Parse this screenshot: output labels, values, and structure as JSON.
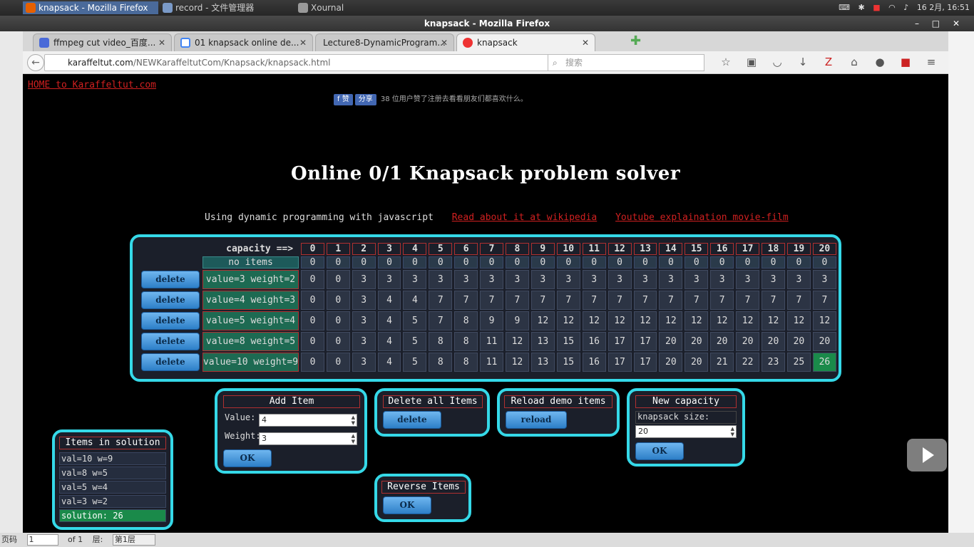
{
  "os": {
    "tasks": [
      "knapsack - Mozilla Firefox",
      "record - 文件管理器",
      "Xournal"
    ],
    "clock": "16 2月, 16:51"
  },
  "window": {
    "title": "knapsack - Mozilla Firefox"
  },
  "browser": {
    "tabs": [
      {
        "label": "ffmpeg cut video_百度..."
      },
      {
        "label": "01 knapsack online de..."
      },
      {
        "label": "Lecture8-DynamicProgram..."
      },
      {
        "label": "knapsack"
      }
    ],
    "url_host": "karaffeltut.com",
    "url_path": "/NEWKaraffeltutCom/Knapsack/knapsack.html",
    "search_placeholder": "搜索"
  },
  "page": {
    "home_link": "HOME to Karaffeltut.com",
    "fb": {
      "like": "赞",
      "share": "分享",
      "text": "38 位用户赞了注册去看看朋友们都喜欢什么。"
    },
    "title": "Online 0/1 Knapsack problem solver",
    "subtitle": "Using dynamic programming with javascript",
    "link_wiki": "Read about it at wikipedia",
    "link_youtube": "Youtube explaination movie-film"
  },
  "table": {
    "capacity_label": "capacity ==>",
    "capacities": [
      "0",
      "1",
      "2",
      "3",
      "4",
      "5",
      "6",
      "7",
      "8",
      "9",
      "10",
      "11",
      "12",
      "13",
      "14",
      "15",
      "16",
      "17",
      "18",
      "19",
      "20"
    ],
    "no_items_label": "no items",
    "no_items_row": [
      "0",
      "0",
      "0",
      "0",
      "0",
      "0",
      "0",
      "0",
      "0",
      "0",
      "0",
      "0",
      "0",
      "0",
      "0",
      "0",
      "0",
      "0",
      "0",
      "0",
      "0"
    ],
    "delete_label": "delete",
    "rows": [
      {
        "label": "value=3 weight=2",
        "values": [
          "0",
          "0",
          "3",
          "3",
          "3",
          "3",
          "3",
          "3",
          "3",
          "3",
          "3",
          "3",
          "3",
          "3",
          "3",
          "3",
          "3",
          "3",
          "3",
          "3",
          "3"
        ]
      },
      {
        "label": "value=4 weight=3",
        "values": [
          "0",
          "0",
          "3",
          "4",
          "4",
          "7",
          "7",
          "7",
          "7",
          "7",
          "7",
          "7",
          "7",
          "7",
          "7",
          "7",
          "7",
          "7",
          "7",
          "7",
          "7"
        ]
      },
      {
        "label": "value=5 weight=4",
        "values": [
          "0",
          "0",
          "3",
          "4",
          "5",
          "7",
          "8",
          "9",
          "9",
          "12",
          "12",
          "12",
          "12",
          "12",
          "12",
          "12",
          "12",
          "12",
          "12",
          "12",
          "12"
        ]
      },
      {
        "label": "value=8 weight=5",
        "values": [
          "0",
          "0",
          "3",
          "4",
          "5",
          "8",
          "8",
          "11",
          "12",
          "13",
          "15",
          "16",
          "17",
          "17",
          "20",
          "20",
          "20",
          "20",
          "20",
          "20",
          "20"
        ]
      },
      {
        "label": "value=10 weight=9",
        "values": [
          "0",
          "0",
          "3",
          "4",
          "5",
          "8",
          "8",
          "11",
          "12",
          "13",
          "15",
          "16",
          "17",
          "17",
          "20",
          "20",
          "21",
          "22",
          "23",
          "25",
          "26"
        ]
      }
    ]
  },
  "add_item": {
    "title": "Add Item",
    "value_label": "Value:",
    "value": "4",
    "weight_label": "Weight:",
    "weight": "3",
    "ok": "OK"
  },
  "delete_all": {
    "title": "Delete all Items",
    "button": "delete"
  },
  "reload": {
    "title": "Reload demo items",
    "button": "reload"
  },
  "new_capacity": {
    "title": "New capacity",
    "label": "knapsack size:",
    "value": "20",
    "ok": "OK"
  },
  "reverse": {
    "title": "Reverse Items",
    "ok": "OK"
  },
  "solution": {
    "title": "Items in solution",
    "items": [
      "val=10 w=9",
      "val=8 w=5",
      "val=5 w=4",
      "val=3 w=2"
    ],
    "total": "solution: 26"
  },
  "bottom": {
    "page_label": "页码",
    "page_value": "1",
    "of": "of 1",
    "layer_label": "层:",
    "layer_value": "第1层"
  }
}
